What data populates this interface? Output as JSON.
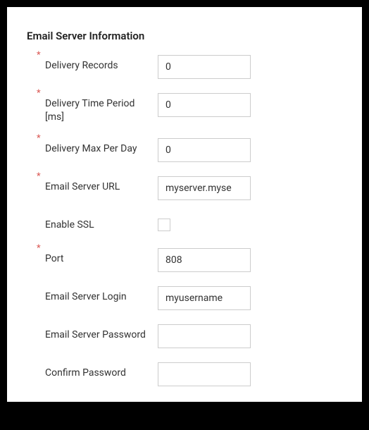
{
  "section": {
    "title": "Email Server Information"
  },
  "fields": {
    "deliveryRecords": {
      "label": "Delivery Records",
      "value": "0",
      "required": true
    },
    "deliveryTimePeriod": {
      "label": "Delivery Time Period [ms]",
      "value": "0",
      "required": true
    },
    "deliveryMaxPerDay": {
      "label": "Delivery Max Per Day",
      "value": "0",
      "required": true
    },
    "emailServerUrl": {
      "label": "Email Server URL",
      "value": "myserver.myse",
      "required": true
    },
    "enableSsl": {
      "label": "Enable SSL",
      "checked": false,
      "required": false
    },
    "port": {
      "label": "Port",
      "value": "808",
      "required": true
    },
    "emailServerLogin": {
      "label": "Email Server Login",
      "value": "myusername",
      "required": false
    },
    "emailServerPassword": {
      "label": "Email Server Password",
      "value": "",
      "required": false
    },
    "confirmPassword": {
      "label": "Confirm Password",
      "value": "",
      "required": false
    }
  }
}
